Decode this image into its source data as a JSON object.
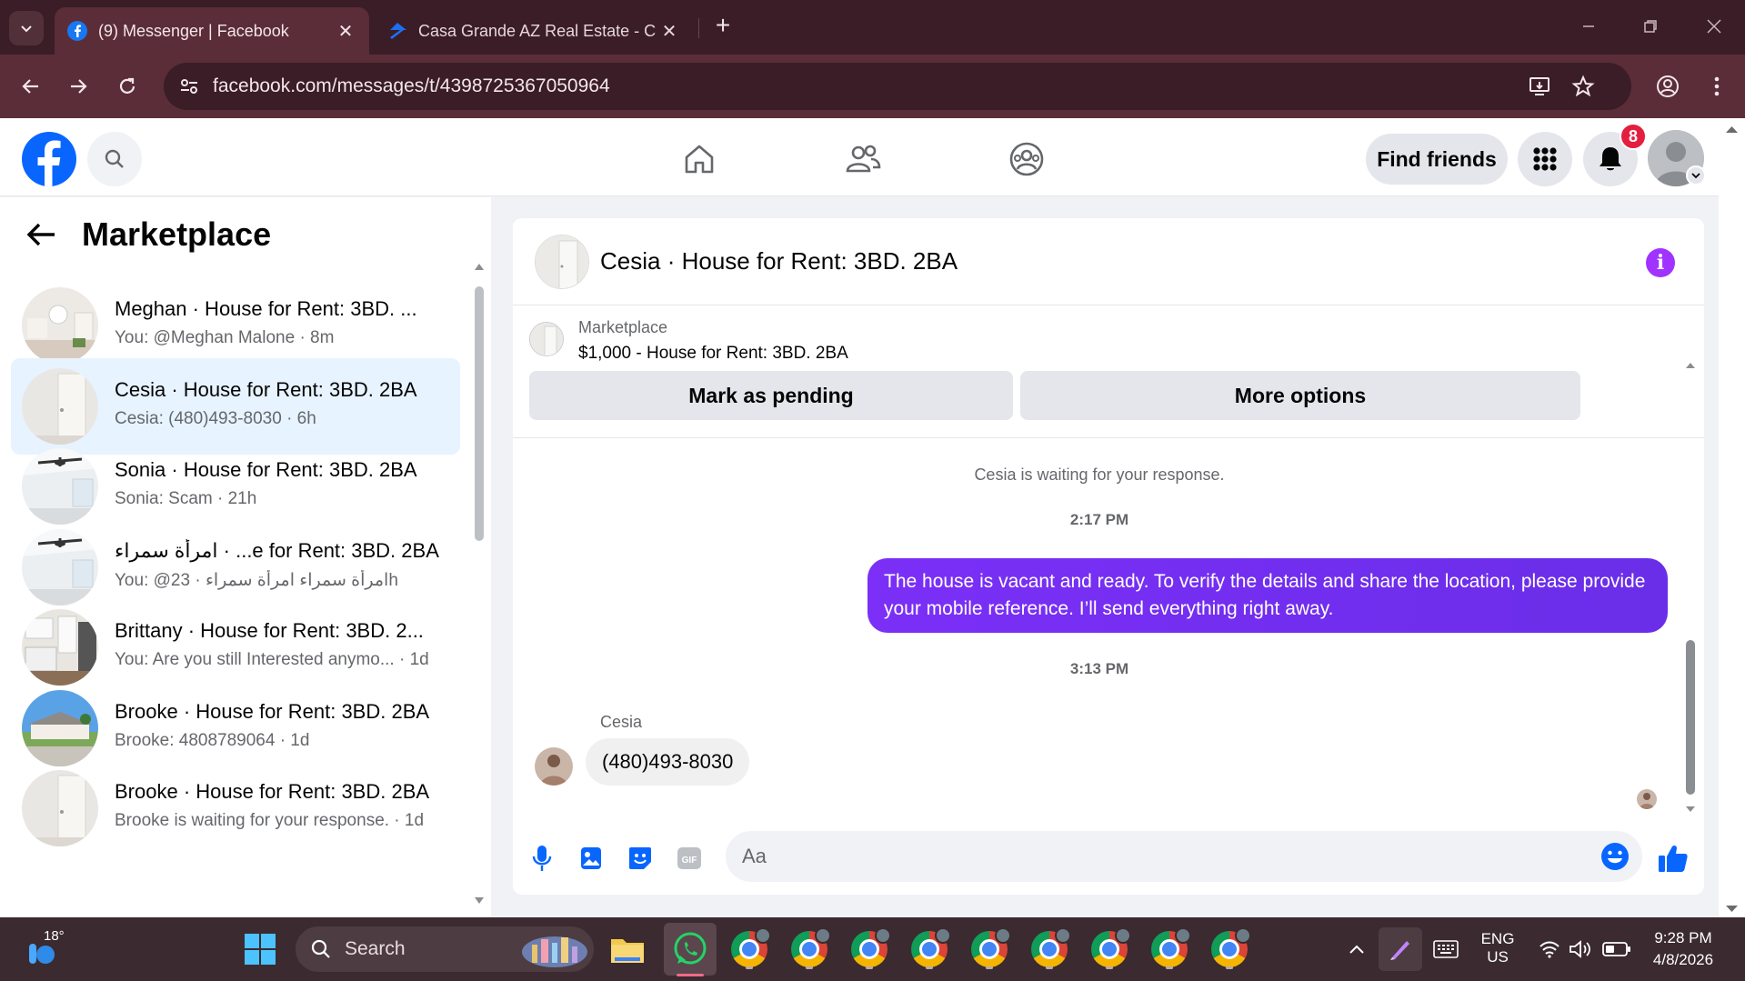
{
  "browser": {
    "tabs": [
      {
        "title": "(9) Messenger | Facebook",
        "active": true
      },
      {
        "title": "Casa Grande AZ Real Estate - C",
        "active": false
      }
    ],
    "url": "facebook.com/messages/t/4398725367050964"
  },
  "fb_header": {
    "find_friends_label": "Find friends",
    "notification_count": "8"
  },
  "sidebar": {
    "title": "Marketplace",
    "conversations": [
      {
        "name": "Meghan · House for Rent: 3BD. ...",
        "preview": "You: @Meghan Malone · 8m",
        "selected": false,
        "thumb": "interior"
      },
      {
        "name": "Cesia · House for Rent: 3BD. 2BA",
        "preview": "Cesia: (480)493-8030 · 6h",
        "selected": true,
        "thumb": "door"
      },
      {
        "name": "Sonia · House for Rent: 3BD. 2BA",
        "preview": "Sonia: Scam · 21h",
        "selected": false,
        "thumb": "fan"
      },
      {
        "name": "امرأة سمراء · ...e for Rent: 3BD. 2BA",
        "preview": "You: @امرأة سمراء امرأة سمراء · 23h",
        "selected": false,
        "thumb": "fan"
      },
      {
        "name": "Brittany · House for Rent: 3BD. 2...",
        "preview": "You: Are you still Interested anymo... · 1d",
        "selected": false,
        "thumb": "kitchen"
      },
      {
        "name": "Brooke · House for Rent: 3BD. 2BA",
        "preview": "Brooke: 4808789064 · 1d",
        "selected": false,
        "thumb": "exterior"
      },
      {
        "name": "Brooke · House for Rent: 3BD. 2BA",
        "preview": "Brooke is waiting for your response. · 1d",
        "selected": false,
        "thumb": "door"
      }
    ]
  },
  "chat": {
    "title": "Cesia · House for Rent: 3BD. 2BA",
    "marketplace_label": "Marketplace",
    "listing": "$1,000 - House for Rent: 3BD. 2BA",
    "mark_pending_label": "Mark as pending",
    "more_options_label": "More options",
    "waiting_text": "Cesia is waiting for your response.",
    "time_1": "2:17 PM",
    "outgoing_message": "The house is vacant and ready. To verify the details and share the location, please provide your mobile reference. I’ll send everything right away.",
    "time_2": "3:13 PM",
    "sender_name": "Cesia",
    "incoming_message": "(480)493-8030",
    "composer_placeholder": "Aa",
    "accent_color": "#7b2ff7"
  },
  "taskbar": {
    "temperature": "18°",
    "search_label": "Search",
    "lang_line1": "ENG",
    "lang_line2": "US",
    "time": "9:28 PM",
    "date": "4/8/2026"
  }
}
